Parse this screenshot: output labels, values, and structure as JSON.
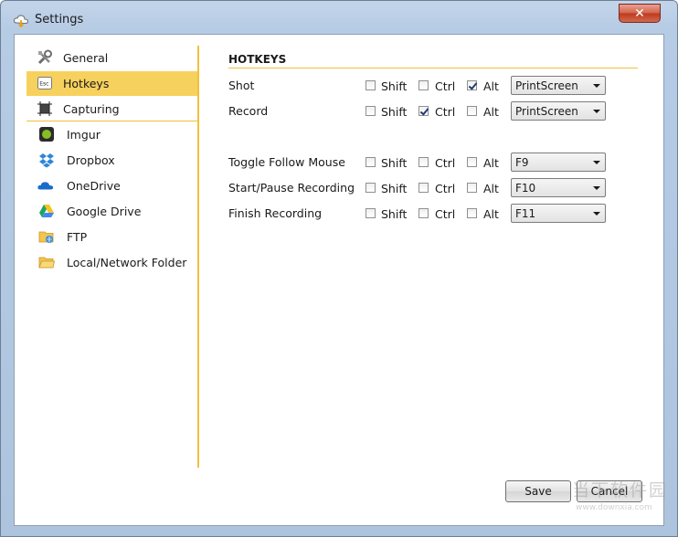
{
  "window": {
    "title": "Settings",
    "close_label": "✕"
  },
  "sidebar": {
    "items": [
      {
        "label": "General",
        "icon": "tools-icon"
      },
      {
        "label": "Hotkeys",
        "icon": "esc-key-icon",
        "active": true
      },
      {
        "label": "Capturing",
        "icon": "capture-icon"
      },
      {
        "label": "Imgur",
        "icon": "imgur-icon"
      },
      {
        "label": "Dropbox",
        "icon": "dropbox-icon"
      },
      {
        "label": "OneDrive",
        "icon": "onedrive-icon"
      },
      {
        "label": "Google Drive",
        "icon": "google-drive-icon"
      },
      {
        "label": "FTP",
        "icon": "ftp-folder-icon"
      },
      {
        "label": "Local/Network Folder",
        "icon": "folder-icon"
      }
    ]
  },
  "hotkeys": {
    "title": "HOTKEYS",
    "modifier_labels": {
      "shift": "Shift",
      "ctrl": "Ctrl",
      "alt": "Alt"
    },
    "rows": [
      {
        "label": "Shot",
        "shift": false,
        "ctrl": false,
        "alt": true,
        "key": "PrintScreen"
      },
      {
        "label": "Record",
        "shift": false,
        "ctrl": true,
        "alt": false,
        "key": "PrintScreen"
      },
      {
        "label": "Toggle Follow Mouse",
        "shift": false,
        "ctrl": false,
        "alt": false,
        "key": "F9"
      },
      {
        "label": "Start/Pause Recording",
        "shift": false,
        "ctrl": false,
        "alt": false,
        "key": "F10"
      },
      {
        "label": "Finish Recording",
        "shift": false,
        "ctrl": false,
        "alt": false,
        "key": "F11"
      }
    ]
  },
  "buttons": {
    "save": "Save",
    "cancel": "Cancel"
  },
  "watermark": {
    "text": "当下软件园",
    "url": "www.downxia.com"
  },
  "colors": {
    "accent": "#f2c03d",
    "active_item": "#f7d15d",
    "close_button": "#c0391e"
  }
}
